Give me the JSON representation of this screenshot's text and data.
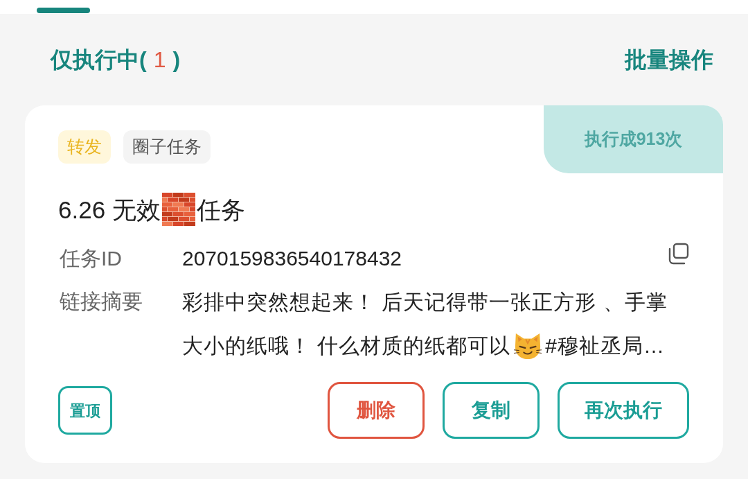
{
  "filter": {
    "label": "仅执行中(",
    "count": "1",
    "close": ")"
  },
  "batch_action": "批量操作",
  "task": {
    "execution_badge": "执行成913次",
    "tags": [
      {
        "text": "转发",
        "kind": "highlight"
      },
      {
        "text": "圈子任务",
        "kind": "plain"
      }
    ],
    "title": [
      {
        "kind": "text",
        "text": "6.26 无效"
      },
      {
        "kind": "emoji"
      },
      {
        "kind": "text",
        "text": "任务"
      }
    ],
    "task_id": {
      "label": "任务ID",
      "value": "2070159836540178432"
    },
    "summary": {
      "label": "链接摘要",
      "lines": [
        [
          {
            "kind": "text",
            "text": "彩排中突然想起来！ 后天记得带一张正方形 、手掌"
          }
        ],
        [
          {
            "kind": "text",
            "text": "大小的纸哦！ 什么材质的纸都可以"
          },
          {
            "kind": "emoji"
          },
          {
            "kind": "text",
            "text": "#穆祉丞局…"
          }
        ]
      ]
    },
    "pin_button": "置顶",
    "actions": [
      {
        "text": "删除",
        "kind": "danger"
      },
      {
        "text": "复制",
        "kind": "normal"
      },
      {
        "text": "再次执行",
        "kind": "normal"
      }
    ]
  }
}
